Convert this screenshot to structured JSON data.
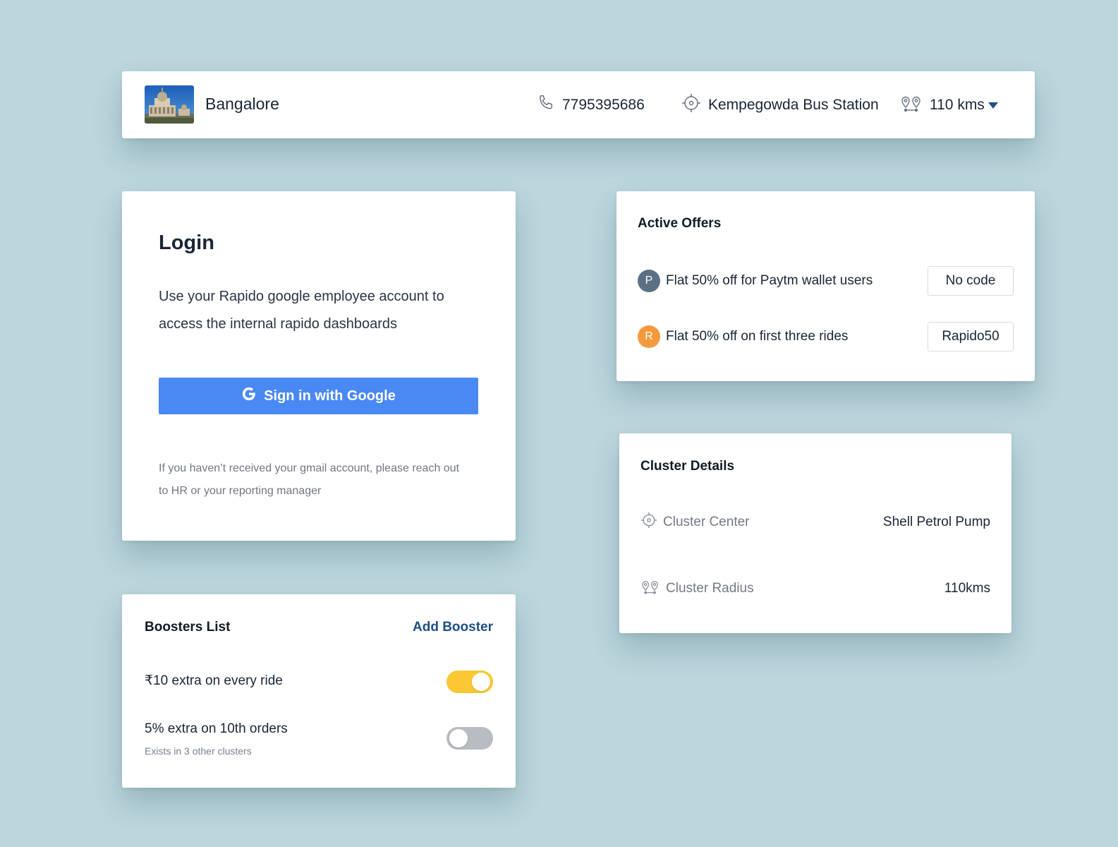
{
  "header": {
    "city": "Bangalore",
    "phone": "7795395686",
    "station": "Kempegowda Bus Station",
    "radius": "110 kms"
  },
  "login": {
    "title": "Login",
    "description": "Use your Rapido google employee account to access the internal rapido dashboards",
    "button_label": "Sign in with Google",
    "note": "If you haven’t received your gmail account, please reach out to HR or your reporting manager"
  },
  "boosters": {
    "title": "Boosters List",
    "add_label": "Add Booster",
    "items": [
      {
        "label": "₹10 extra on every ride",
        "sub": "",
        "enabled": true
      },
      {
        "label": "5% extra on 10th orders",
        "sub": "Exists in 3 other clusters",
        "enabled": false
      }
    ]
  },
  "offers": {
    "title": "Active Offers",
    "items": [
      {
        "avatar": "P",
        "avatar_color": "#5b7085",
        "text": "Flat 50% off for Paytm wallet users",
        "code": "No code"
      },
      {
        "avatar": "R",
        "avatar_color": "#f39a3c",
        "text": "Flat 50% off on first three rides",
        "code": "Rapido50"
      }
    ]
  },
  "cluster": {
    "title": "Cluster Details",
    "center_label": "Cluster Center",
    "center_value": "Shell Petrol Pump",
    "radius_label": "Cluster Radius",
    "radius_value": "110kms"
  },
  "colors": {
    "background": "#bbd6dc",
    "primary_button": "#4a89f3",
    "link": "#1d4f86",
    "toggle_on": "#f9c833",
    "toggle_off": "#b8bcc3"
  },
  "icons": [
    "phone-icon",
    "crosshair-icon",
    "pins-icon",
    "chevron-down-icon",
    "google-icon"
  ]
}
